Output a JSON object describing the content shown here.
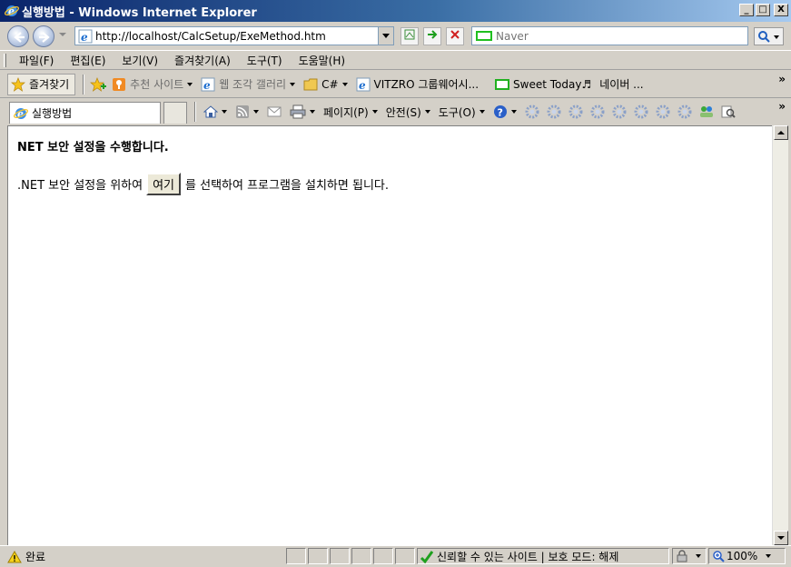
{
  "window": {
    "title": "실행방법 - Windows Internet Explorer",
    "buttons": [
      "_",
      "□",
      "X"
    ]
  },
  "address_bar": {
    "url": "http://localhost/CalcSetup/ExeMethod.htm",
    "back_icon": "back-arrow-icon",
    "forward_icon": "forward-arrow-icon"
  },
  "search": {
    "placeholder": "Naver",
    "provider_icon": "naver-icon"
  },
  "menu": {
    "items": [
      "파일(F)",
      "편집(E)",
      "보기(V)",
      "즐겨찾기(A)",
      "도구(T)",
      "도움말(H)"
    ]
  },
  "favorites_bar": {
    "favorites_label": "즐겨찾기",
    "items": [
      {
        "label": "추천 사이트",
        "icon": "suggested-sites-icon",
        "dropdown": true
      },
      {
        "label": "웹 조각 갤러리",
        "icon": "web-slice-icon",
        "dropdown": true
      },
      {
        "label": "C#",
        "icon": "folder-icon",
        "dropdown": true
      },
      {
        "label": "VITZRO 그룹웨어시...",
        "icon": "ie-page-icon",
        "dropdown": false
      },
      {
        "label": "Sweet Today♬",
        "icon": "green-page-icon",
        "dropdown": false
      },
      {
        "label": "네이버 ...",
        "icon": "none",
        "dropdown": false
      }
    ],
    "overflow": "»"
  },
  "tabs": {
    "active_tab": "실행방법"
  },
  "command_bar": {
    "page_label": "페이지(P)",
    "safety_label": "안전(S)",
    "tools_label": "도구(O)",
    "overflow": "»"
  },
  "page": {
    "heading": "NET 보안 설정을 수행합니다.",
    "text_before": ".NET 보안 설정을 위하여",
    "button_label": "여기",
    "text_after": "를 선택하여 프로그램을 설치하면 됩니다."
  },
  "status_bar": {
    "status": "완료",
    "zone_text": "신뢰할 수 있는 사이트 | 보호 모드: 해제",
    "zoom": "100%"
  },
  "colors": {
    "title_bar_start": "#0a246a",
    "title_bar_end": "#a6caf0",
    "chrome": "#d4d0c8"
  }
}
